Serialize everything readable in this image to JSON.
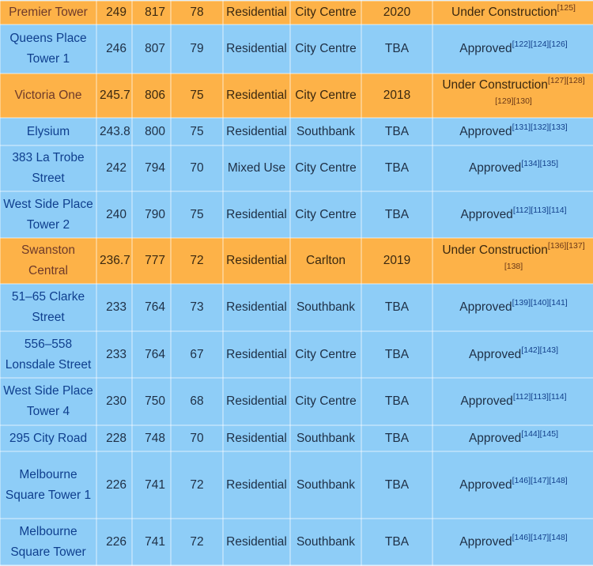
{
  "colors": {
    "approved": "#8ecdf7",
    "under_construction": "#fdb248"
  },
  "rows": [
    {
      "name": "Premier Tower",
      "m": "249",
      "ft": "817",
      "floors": "78",
      "use": "Residential",
      "location": "City Centre",
      "year": "2020",
      "status": "Under Construction",
      "refs": "[125]",
      "type": "construction"
    },
    {
      "name": "Queens Place Tower 1",
      "m": "246",
      "ft": "807",
      "floors": "79",
      "use": "Residential",
      "location": "City Centre",
      "year": "TBA",
      "status": "Approved",
      "refs": "[122][124][126]",
      "type": "approved"
    },
    {
      "name": "Victoria One",
      "m": "245.7",
      "ft": "806",
      "floors": "75",
      "use": "Residential",
      "location": "City Centre",
      "year": "2018",
      "status": "Under Construction",
      "refs": "[127][128][129][130]",
      "type": "construction"
    },
    {
      "name": "Elysium",
      "m": "243.8",
      "ft": "800",
      "floors": "75",
      "use": "Residential",
      "location": "Southbank",
      "year": "TBA",
      "status": "Approved",
      "refs": "[131][132][133]",
      "type": "approved"
    },
    {
      "name": "383 La Trobe Street",
      "m": "242",
      "ft": "794",
      "floors": "70",
      "use": "Mixed Use",
      "location": "City Centre",
      "year": "TBA",
      "status": "Approved",
      "refs": "[134][135]",
      "type": "approved"
    },
    {
      "name": "West Side Place Tower 2",
      "m": "240",
      "ft": "790",
      "floors": "75",
      "use": "Residential",
      "location": "City Centre",
      "year": "TBA",
      "status": "Approved",
      "refs": "[112][113][114]",
      "type": "approved"
    },
    {
      "name": "Swanston Central",
      "m": "236.7",
      "ft": "777",
      "floors": "72",
      "use": "Residential",
      "location": "Carlton",
      "year": "2019",
      "status": "Under Construction",
      "refs": "[136][137][138]",
      "type": "construction"
    },
    {
      "name": "51–65 Clarke Street",
      "m": "233",
      "ft": "764",
      "floors": "73",
      "use": "Residential",
      "location": "Southbank",
      "year": "TBA",
      "status": "Approved",
      "refs": "[139][140][141]",
      "type": "approved"
    },
    {
      "name": "556–558 Lonsdale Street",
      "m": "233",
      "ft": "764",
      "floors": "67",
      "use": "Residential",
      "location": "City Centre",
      "year": "TBA",
      "status": "Approved",
      "refs": "[142][143]",
      "type": "approved"
    },
    {
      "name": "West Side Place Tower 4",
      "m": "230",
      "ft": "750",
      "floors": "68",
      "use": "Residential",
      "location": "City Centre",
      "year": "TBA",
      "status": "Approved",
      "refs": "[112][113][114]",
      "type": "approved"
    },
    {
      "name": "295 City Road",
      "m": "228",
      "ft": "748",
      "floors": "70",
      "use": "Residential",
      "location": "Southbank",
      "year": "TBA",
      "status": "Approved",
      "refs": "[144][145]",
      "type": "approved"
    },
    {
      "name": "Melbourne Square Tower 1",
      "m": "226",
      "ft": "741",
      "floors": "72",
      "use": "Residential",
      "location": "Southbank",
      "year": "TBA",
      "status": "Approved",
      "refs": "[146][147][148]",
      "type": "approved"
    },
    {
      "name": "Melbourne Square Tower",
      "m": "226",
      "ft": "741",
      "floors": "72",
      "use": "Residential",
      "location": "Southbank",
      "year": "TBA",
      "status": "Approved",
      "refs": "[146][147][148]",
      "type": "approved"
    }
  ]
}
